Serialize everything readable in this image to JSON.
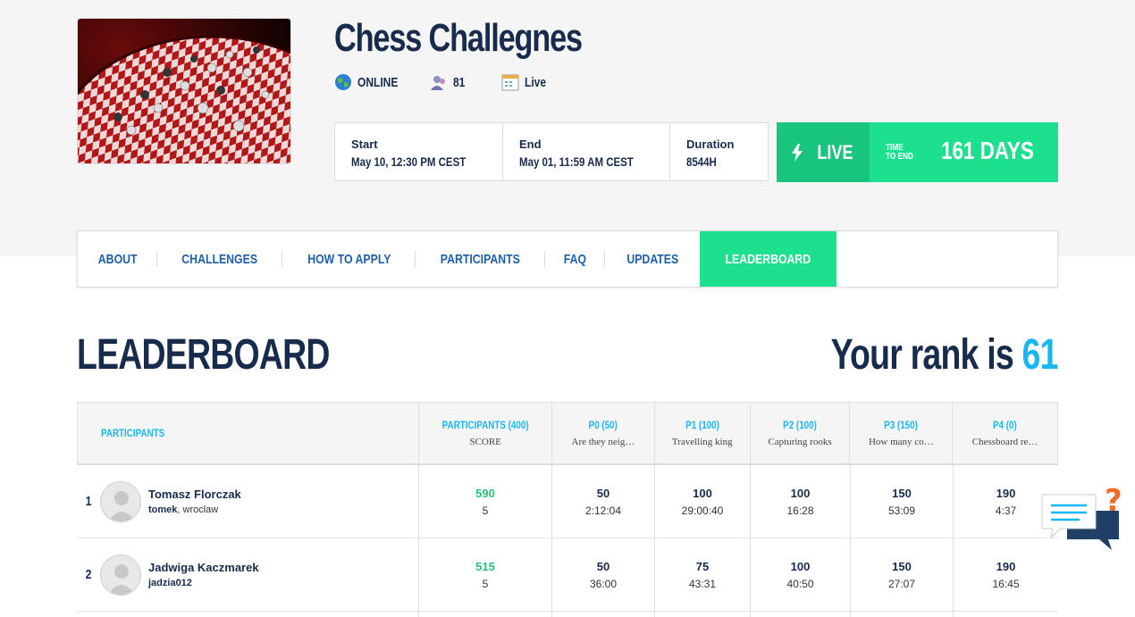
{
  "header": {
    "title": "Chess Challegnes",
    "status": "ONLINE",
    "participants_count": "81",
    "mode": "Live"
  },
  "dates": {
    "start_label": "Start",
    "start_value": "May 10, 12:30 PM CEST",
    "end_label": "End",
    "end_value": "May 01, 11:59 AM CEST",
    "duration_label": "Duration",
    "duration_value": "8544H"
  },
  "live": {
    "label": "LIVE",
    "time_to_end_line1": "TIME",
    "time_to_end_line2": "TO END",
    "remaining": "161 DAYS"
  },
  "tabs": [
    "ABOUT",
    "CHALLENGES",
    "HOW TO APPLY",
    "PARTICIPANTS",
    "FAQ",
    "UPDATES",
    "LEADERBOARD"
  ],
  "leaderboard": {
    "title": "LEADERBOARD",
    "rank_prefix": "Your rank is",
    "rank_value": "61",
    "columns": [
      {
        "h1": "PARTICIPANTS",
        "h2": ""
      },
      {
        "h1": "PARTICIPANTS (400)",
        "h2": "SCORE"
      },
      {
        "h1": "P0 (50)",
        "h2": "Are they neig…"
      },
      {
        "h1": "P1 (100)",
        "h2": "Travelling king"
      },
      {
        "h1": "P2 (100)",
        "h2": "Capturing rooks"
      },
      {
        "h1": "P3 (150)",
        "h2": "How many co…"
      },
      {
        "h1": "P4 (0)",
        "h2": "Chessboard re…"
      }
    ],
    "rows": [
      {
        "rank": "1",
        "name": "Tomasz Florczak",
        "login": "tomek",
        "city": ", wroclaw",
        "score": "590",
        "score_sub": "5",
        "cells": [
          [
            "50",
            "2:12:04"
          ],
          [
            "100",
            "29:00:40"
          ],
          [
            "100",
            "16:28"
          ],
          [
            "150",
            "53:09"
          ],
          [
            "190",
            "4:37"
          ]
        ]
      },
      {
        "rank": "2",
        "name": "Jadwiga Kaczmarek",
        "login": "jadzia012",
        "city": "",
        "score": "515",
        "score_sub": "5",
        "cells": [
          [
            "50",
            "36:00"
          ],
          [
            "75",
            "43:31"
          ],
          [
            "100",
            "40:50"
          ],
          [
            "150",
            "27:07"
          ],
          [
            "190",
            "16:45"
          ]
        ]
      }
    ]
  },
  "colors": {
    "navy": "#172b4d",
    "green": "#1de08f",
    "green_dark": "#19c47f",
    "blue": "#1ab6f0",
    "tab_blue": "#1f5fa8"
  },
  "icons": [
    "globe-icon",
    "users-icon",
    "calendar-icon",
    "lightning-icon",
    "chat-help-icon",
    "avatar-placeholder-icon"
  ]
}
